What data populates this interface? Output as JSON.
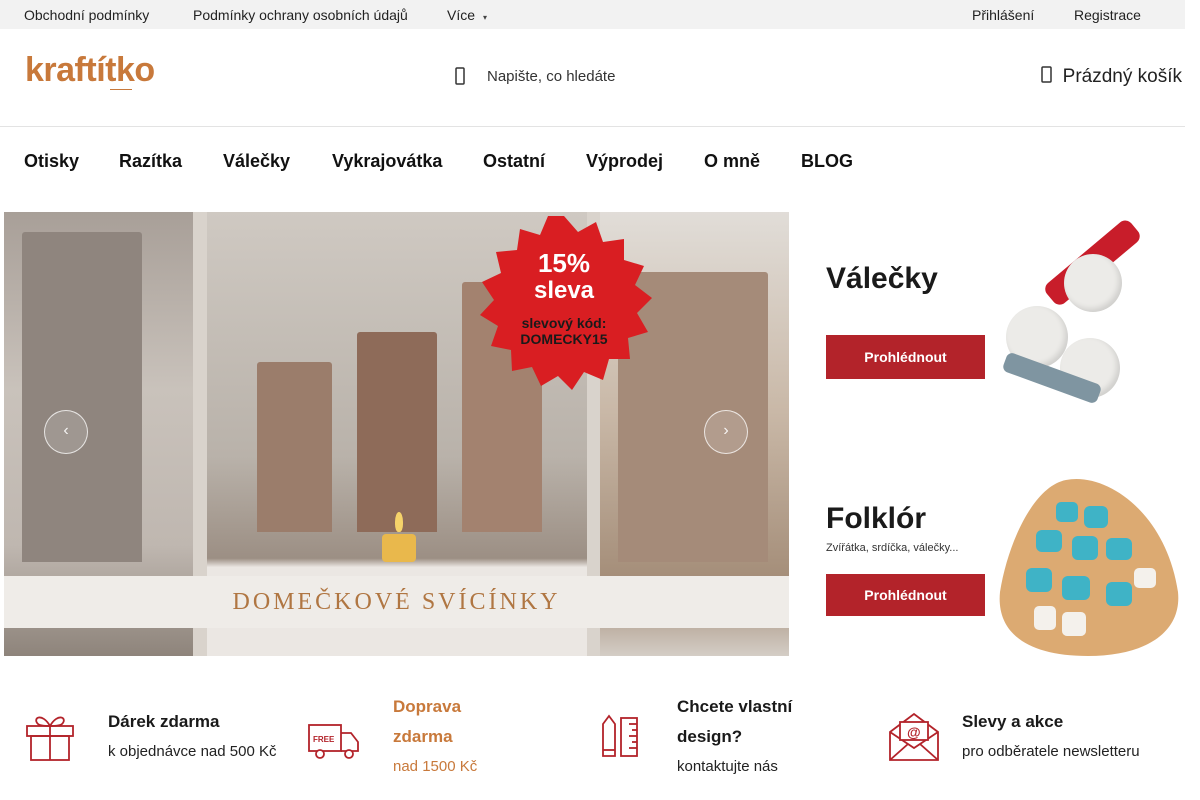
{
  "topbar": {
    "links": [
      "Obchodní podmínky",
      "Podmínky ochrany osobních údajů"
    ],
    "more_label": "Více",
    "login_label": "Přihlášení",
    "register_label": "Registrace"
  },
  "header": {
    "logo_text": "kraftítko",
    "search_placeholder": "Napište, co hledáte",
    "cart_label": "Prázdný košík",
    "icons": {
      "search": "search-icon",
      "cart": "cart-icon"
    }
  },
  "nav": {
    "items": [
      "Otisky",
      "Razítka",
      "Válečky",
      "Vykrajovátka",
      "Ostatní",
      "Výprodej",
      "O mně",
      "BLOG"
    ]
  },
  "hero": {
    "badge_percent": "15%",
    "badge_word": "sleva",
    "badge_code_label": "slevový kód:",
    "badge_code": "DOMECKY15",
    "caption": "DOMEČKOVÉ SVÍCÍNKY",
    "prev_icon": "chevron-left-icon",
    "next_icon": "chevron-right-icon"
  },
  "side_banners": [
    {
      "title": "Válečky",
      "subtitle": "",
      "button": "Prohlédnout"
    },
    {
      "title": "Folklór",
      "subtitle": "Zvířátka, srdíčka, válečky...",
      "button": "Prohlédnout"
    }
  ],
  "features": [
    {
      "title": "Dárek zdarma",
      "subtitle": "k objednávce nad 500 Kč",
      "icon": "gift-icon"
    },
    {
      "title_line1": "Doprava",
      "title_line2": "zdarma",
      "subtitle": "nad 1500 Kč",
      "icon": "free-delivery-truck-icon",
      "badge": "FREE"
    },
    {
      "title_line1": "Chcete vlastní",
      "title_line2": "design?",
      "subtitle": "kontaktujte nás",
      "icon": "pencil-ruler-icon"
    },
    {
      "title": "Slevy a akce",
      "subtitle": "pro odběratele newsletteru",
      "icon": "newsletter-envelope-icon"
    }
  ],
  "colors": {
    "accent": "#c8793b",
    "red": "#b3232a",
    "topbar_bg": "#f2f2f2"
  }
}
